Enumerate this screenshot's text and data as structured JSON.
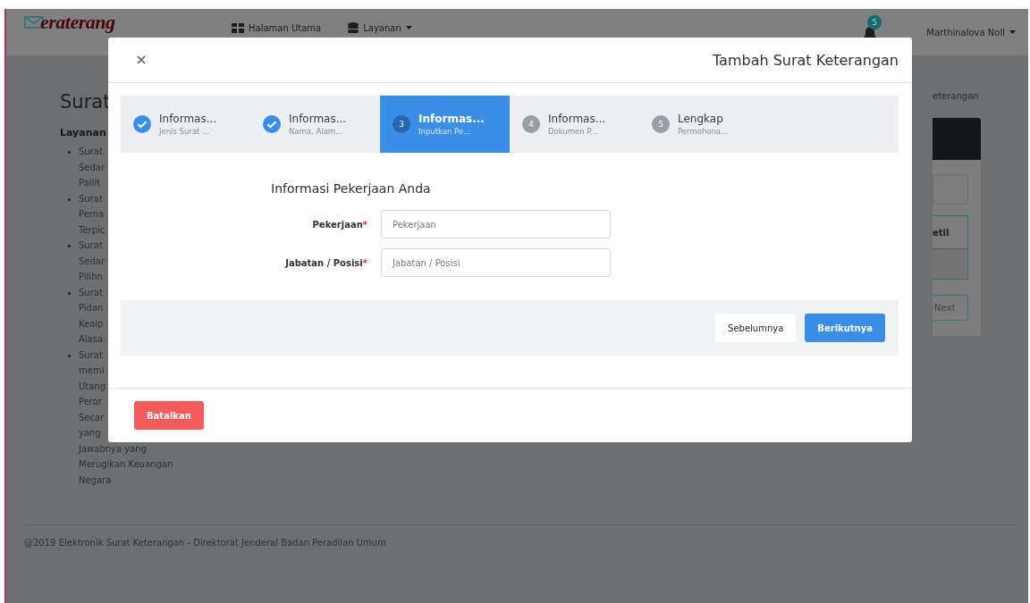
{
  "navbar": {
    "logo": "eraterang",
    "links": [
      {
        "label": "Halaman Utama",
        "dropdown": false
      },
      {
        "label": "Layanan",
        "dropdown": true
      }
    ],
    "notification_count": "5",
    "user": "Marthinalova Noll"
  },
  "page": {
    "heading": "Surat",
    "sidebar_title": "Layanan",
    "services": [
      {
        "lines": [
          "Surat",
          "Sedar",
          "Pailit"
        ]
      },
      {
        "lines": [
          "Surat",
          "Perna",
          "Terpic"
        ]
      },
      {
        "lines": [
          "Surat",
          "Sedar",
          "Pilihn"
        ]
      },
      {
        "lines": [
          "Surat",
          "Pidan",
          "Kealp",
          "Alasa"
        ]
      },
      {
        "lines": [
          "Surat",
          "memi",
          "Utang",
          "Peror",
          "Secar",
          "yang",
          "Jawabnya yang",
          "Merugikan Keuangan",
          "Negara"
        ]
      }
    ],
    "breadcrumb": "eterangan",
    "table_header": "etil",
    "next_button": "Next"
  },
  "footer": "@2019 Elektronik Surat Keterangan - Direktorat Jenderal Badan Peradilan Umum",
  "modal": {
    "title": "Tambah Surat Keterangan",
    "steps": [
      {
        "title": "Informas...",
        "subtitle": "Jenis Surat ...",
        "done": true,
        "selected": false
      },
      {
        "title": "Informas...",
        "subtitle": "Nama, Alam...",
        "done": true,
        "selected": false
      },
      {
        "number": "3",
        "title": "Informas...",
        "subtitle": "Inputkan Pe...",
        "done": false,
        "selected": true
      },
      {
        "number": "4",
        "title": "Informas...",
        "subtitle": "Dokumen P...",
        "done": false,
        "selected": false
      },
      {
        "number": "5",
        "title": "Lengkap",
        "subtitle": "Permohona...",
        "done": false,
        "selected": false
      }
    ],
    "form_title": "Informasi Pekerjaan Anda",
    "fields": [
      {
        "label": "Pekerjaan",
        "mark": "*",
        "placeholder": "Pekerjaan"
      },
      {
        "label": "Jabatan / Posisi",
        "mark": "*",
        "placeholder": "Jabatan / Posisi"
      }
    ],
    "prev_button": "Sebelumnya",
    "next_button": "Berikutnya",
    "cancel_button": "Batalkan"
  }
}
